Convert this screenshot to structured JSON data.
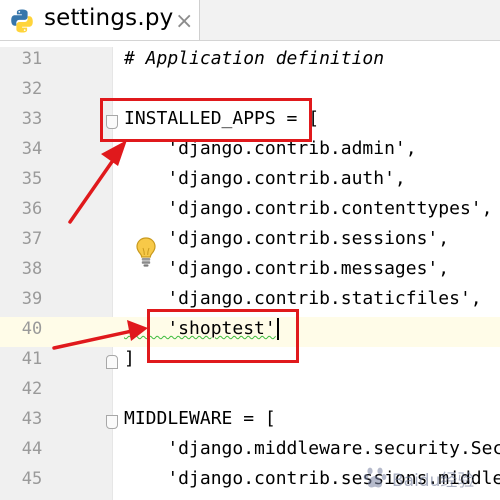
{
  "tab": {
    "filename": "settings.py",
    "close_symbol": "×",
    "icon": "python-icon"
  },
  "lines": [
    {
      "num": "31",
      "code": "# Application definition"
    },
    {
      "num": "32",
      "code": ""
    },
    {
      "num": "33",
      "code": "INSTALLED_APPS = ["
    },
    {
      "num": "34",
      "code": "    'django.contrib.admin',"
    },
    {
      "num": "35",
      "code": "    'django.contrib.auth',"
    },
    {
      "num": "36",
      "code": "    'django.contrib.contenttypes',"
    },
    {
      "num": "37",
      "code": "    'django.contrib.sessions',"
    },
    {
      "num": "38",
      "code": "    'django.contrib.messages',"
    },
    {
      "num": "39",
      "code": "    'django.contrib.staticfiles',"
    },
    {
      "num": "40",
      "code": "    'shoptest'"
    },
    {
      "num": "41",
      "code": "]"
    },
    {
      "num": "42",
      "code": ""
    },
    {
      "num": "43",
      "code": "MIDDLEWARE = ["
    },
    {
      "num": "44",
      "code": "    'django.middleware.security.Sec"
    },
    {
      "num": "45",
      "code": "    'django.contrib.sessions.middle"
    }
  ],
  "current_line": "40",
  "intention_icon": "lightbulb-icon",
  "watermark": "Baidu经验",
  "colors": {
    "annotation_red": "#e0191c",
    "string_green": "#067d17",
    "comment_gray": "#808080",
    "current_line_bg": "#fffce8"
  }
}
